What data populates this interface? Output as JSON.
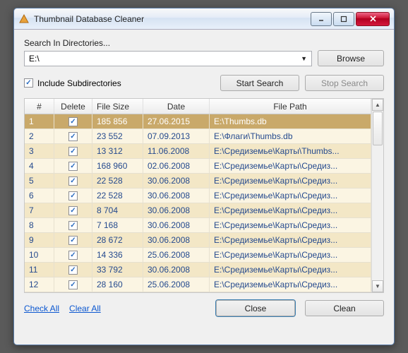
{
  "window": {
    "title": "Thumbnail Database Cleaner"
  },
  "search": {
    "label": "Search In Directories...",
    "path": "E:\\",
    "browse": "Browse",
    "include_sub": "Include Subdirectories",
    "start": "Start Search",
    "stop": "Stop Search"
  },
  "columns": {
    "num": "#",
    "del": "Delete",
    "size": "File Size",
    "date": "Date",
    "path": "File Path"
  },
  "rows": [
    {
      "n": "1",
      "chk": true,
      "size": "185 856",
      "date": "27.06.2015",
      "path": "E:\\Thumbs.db",
      "sel": true
    },
    {
      "n": "2",
      "chk": true,
      "size": "23 552",
      "date": "07.09.2013",
      "path": "E:\\Флаги\\Thumbs.db"
    },
    {
      "n": "3",
      "chk": true,
      "size": "13 312",
      "date": "11.06.2008",
      "path": "E:\\Средиземье\\Карты\\Thumbs..."
    },
    {
      "n": "4",
      "chk": true,
      "size": "168 960",
      "date": "02.06.2008",
      "path": "E:\\Средиземье\\Карты\\Средиз..."
    },
    {
      "n": "5",
      "chk": true,
      "size": "22 528",
      "date": "30.06.2008",
      "path": "E:\\Средиземье\\Карты\\Средиз..."
    },
    {
      "n": "6",
      "chk": true,
      "size": "22 528",
      "date": "30.06.2008",
      "path": "E:\\Средиземье\\Карты\\Средиз..."
    },
    {
      "n": "7",
      "chk": true,
      "size": "8 704",
      "date": "30.06.2008",
      "path": "E:\\Средиземье\\Карты\\Средиз..."
    },
    {
      "n": "8",
      "chk": true,
      "size": "7 168",
      "date": "30.06.2008",
      "path": "E:\\Средиземье\\Карты\\Средиз..."
    },
    {
      "n": "9",
      "chk": true,
      "size": "28 672",
      "date": "30.06.2008",
      "path": "E:\\Средиземье\\Карты\\Средиз..."
    },
    {
      "n": "10",
      "chk": true,
      "size": "14 336",
      "date": "25.06.2008",
      "path": "E:\\Средиземье\\Карты\\Средиз..."
    },
    {
      "n": "11",
      "chk": true,
      "size": "33 792",
      "date": "30.06.2008",
      "path": "E:\\Средиземье\\Карты\\Средиз..."
    },
    {
      "n": "12",
      "chk": true,
      "size": "28 160",
      "date": "25.06.2008",
      "path": "E:\\Средиземье\\Карты\\Средиз..."
    }
  ],
  "footer": {
    "check_all": "Check All",
    "clear_all": "Clear All",
    "close": "Close",
    "clean": "Clean"
  }
}
